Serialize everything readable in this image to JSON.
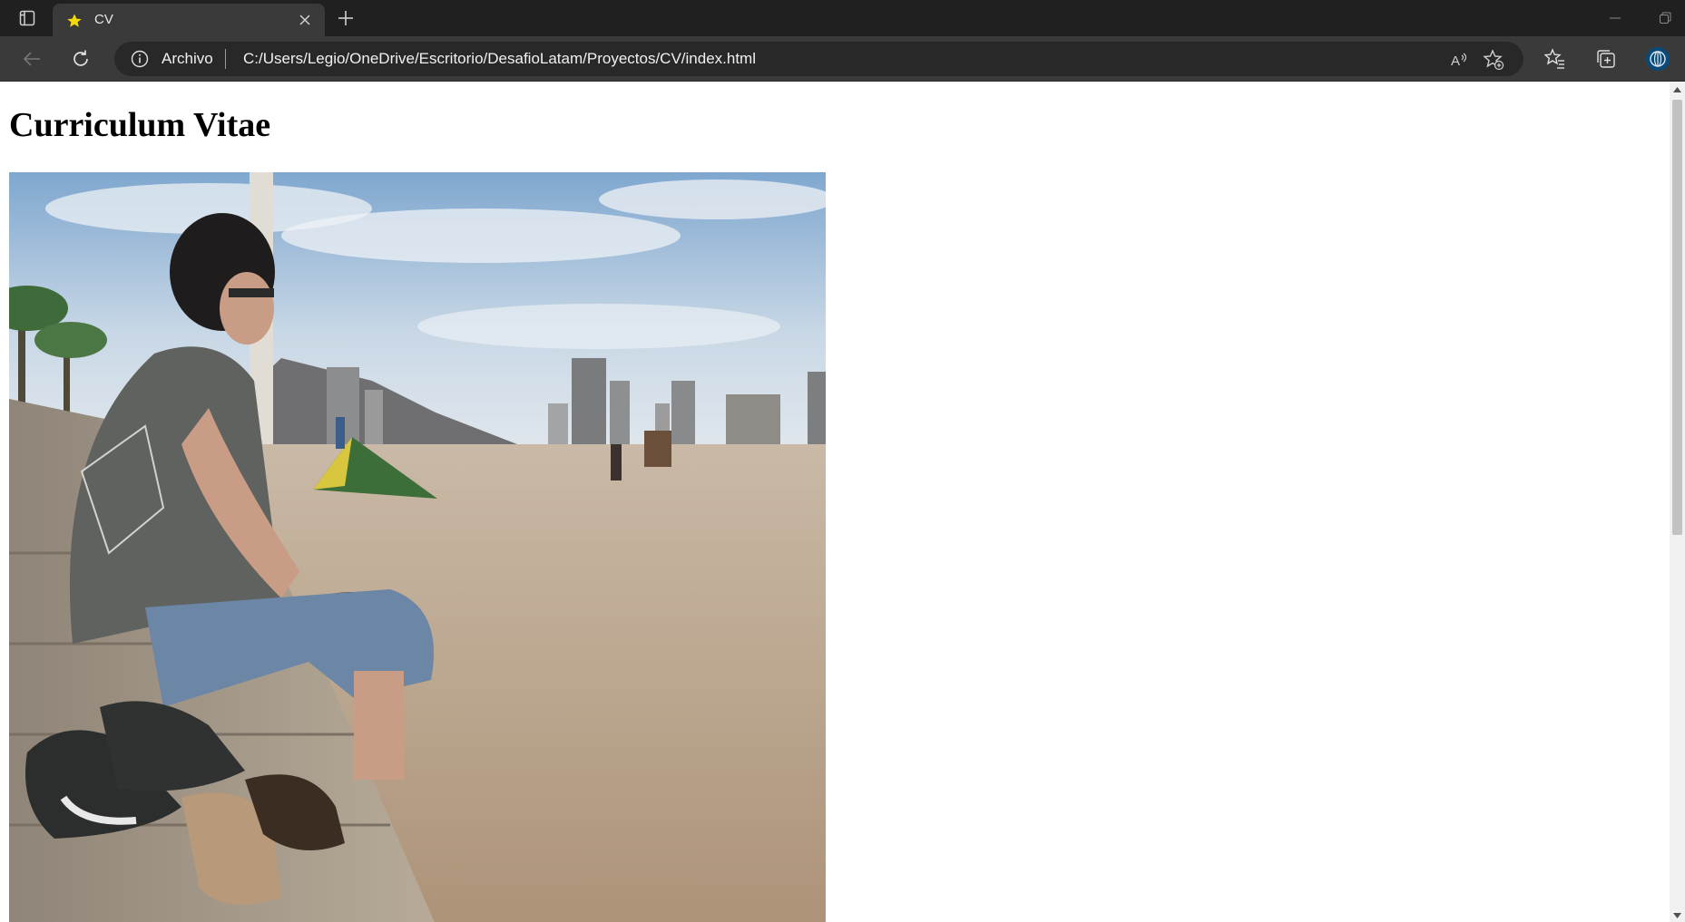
{
  "browser": {
    "tab": {
      "title": "CV",
      "favicon": "star-icon",
      "favicon_color": "#f5d90a"
    },
    "icons": {
      "tab_actions": "tab-actions-icon",
      "close_tab": "close-icon",
      "new_tab": "plus-icon",
      "back": "back-arrow-icon",
      "refresh": "refresh-icon",
      "read_aloud": "read-aloud-icon",
      "add_favorite": "add-favorite-icon",
      "favorites": "favorites-icon",
      "collections": "collections-icon",
      "profile": "profile-icon"
    },
    "address_bar": {
      "scheme_label": "Archivo",
      "url": "C:/Users/Legio/OneDrive/Escritorio/DesafioLatam/Proyectos/CV/index.html"
    },
    "colors": {
      "chrome_dark": "#202020",
      "toolbar": "#3a3a3a",
      "address_bg": "#282828",
      "profile_accent": "#0a4a7a"
    }
  },
  "page": {
    "title": "Curriculum Vitae",
    "photo_icon": "profile-photo"
  }
}
